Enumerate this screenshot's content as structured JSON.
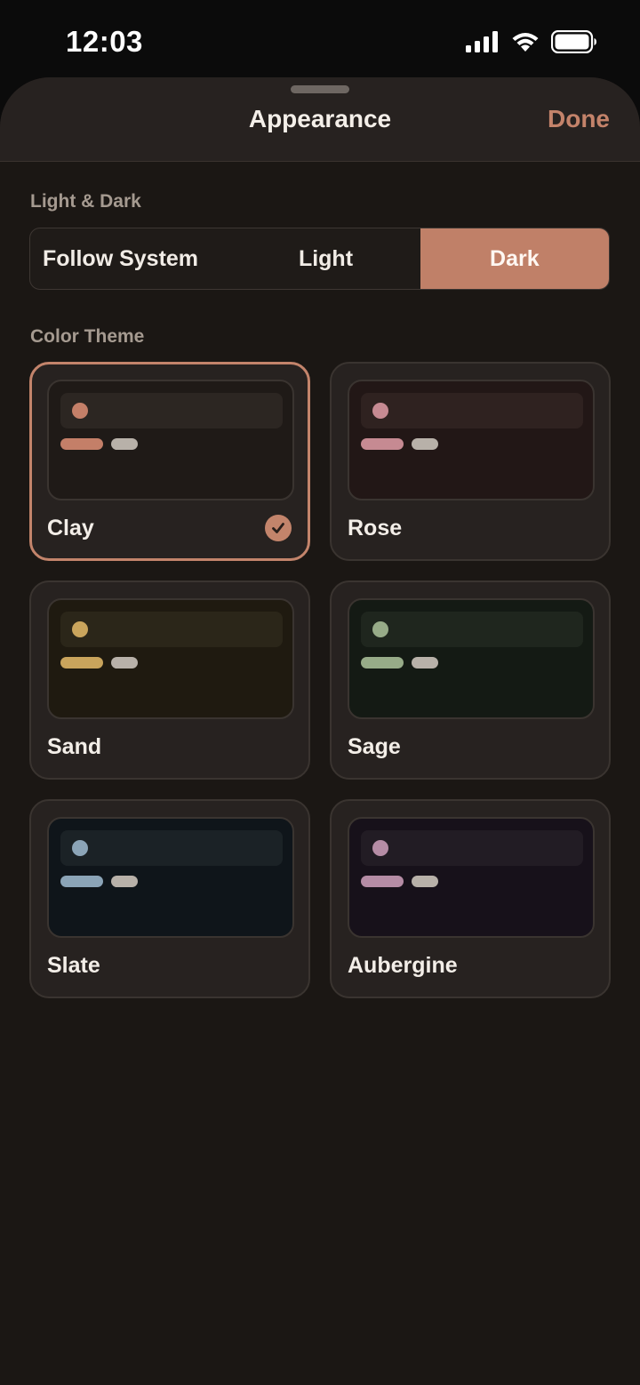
{
  "status_bar": {
    "time": "12:03",
    "icons": [
      "cellular-signal-icon",
      "wifi-icon",
      "battery-icon"
    ]
  },
  "sheet": {
    "title": "Appearance",
    "done_label": "Done"
  },
  "light_dark": {
    "label": "Light & Dark",
    "options": [
      "Follow System",
      "Light",
      "Dark"
    ],
    "selected": "Dark"
  },
  "color_theme": {
    "label": "Color Theme",
    "selected": "Clay",
    "themes": [
      {
        "name": "Clay",
        "accent": "#c47f68",
        "surface": "#1f1a17",
        "bar": "#2c2622"
      },
      {
        "name": "Rose",
        "accent": "#c68a92",
        "surface": "#221716",
        "bar": "#2f2220"
      },
      {
        "name": "Sand",
        "accent": "#c9a45c",
        "surface": "#1f1a10",
        "bar": "#2b2619"
      },
      {
        "name": "Sage",
        "accent": "#97ab88",
        "surface": "#141a14",
        "bar": "#1f261e"
      },
      {
        "name": "Slate",
        "accent": "#8ba4b7",
        "surface": "#0f151a",
        "bar": "#1b2226"
      },
      {
        "name": "Aubergine",
        "accent": "#b58ca5",
        "surface": "#17111a",
        "bar": "#221c24"
      }
    ]
  },
  "colors": {
    "accent": "#c3846b",
    "sheet_background": "#1b1714",
    "card_background": "#272220"
  }
}
